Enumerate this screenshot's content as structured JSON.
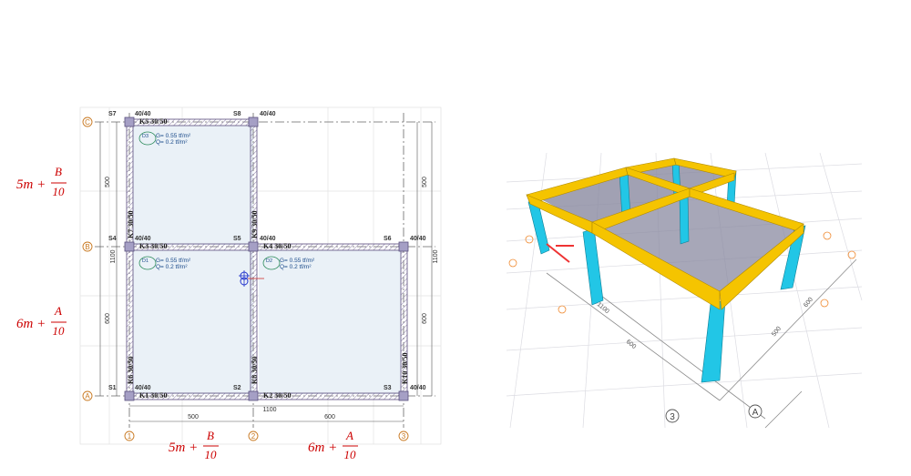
{
  "plan": {
    "grid_axes": {
      "vertical": [
        "1",
        "2",
        "3"
      ],
      "horizontal": [
        "A",
        "B",
        "C"
      ]
    },
    "columns": [
      {
        "id": "S1",
        "size": "40/40"
      },
      {
        "id": "S2",
        "size": ""
      },
      {
        "id": "S3",
        "size": "40/40"
      },
      {
        "id": "S4",
        "size": "40/40"
      },
      {
        "id": "S5",
        "size": "40/40"
      },
      {
        "id": "S6",
        "size": "40/40"
      },
      {
        "id": "S7",
        "size": "40/40"
      },
      {
        "id": "S8",
        "size": "40/40"
      }
    ],
    "beams": {
      "K1": "K1 30/50",
      "K2": "K2 30/50",
      "K3": "K3 30/50",
      "K4": "K4 30/50",
      "K5": "K5 30/50",
      "K6": "K6 30/50",
      "K7": "K7 30/50",
      "K8": "K8 30/50",
      "K9": "K9 30/50",
      "K10": "K10 30/50"
    },
    "slabs": [
      {
        "id": "D3",
        "g": "G= 0.55 tf/m²",
        "q": "Q= 0.2 tf/m²"
      },
      {
        "id": "D1",
        "g": "G= 0.55 tf/m²",
        "q": "Q= 0.2 tf/m²"
      },
      {
        "id": "D2",
        "g": "G= 0.55 tf/m²",
        "q": "Q= 0.2 tf/m²"
      }
    ],
    "dimensions": {
      "bottom_left": "500",
      "bottom_right": "600",
      "bottom_mid": "1100",
      "left_top": "500",
      "left_bottom": "600",
      "left_total": "1100",
      "right_top": "500",
      "right_bottom": "600",
      "right_total": "1100"
    }
  },
  "formulas": {
    "left_top": {
      "base": "5m +",
      "num": "B",
      "den": "10"
    },
    "left_bottom": {
      "base": "6m +",
      "num": "A",
      "den": "10"
    },
    "bottom_left": {
      "base": "5m +",
      "num": "B",
      "den": "10"
    },
    "bottom_right": {
      "base": "6m +",
      "num": "A",
      "den": "10"
    }
  },
  "view3d": {
    "axis_labels": [
      "3",
      "A"
    ],
    "dims": [
      "600",
      "500",
      "1100",
      "600"
    ],
    "colors": {
      "beam": "#f5c400",
      "column": "#22c6e6",
      "slab": "#8a8aa0",
      "grid": "#d9d9df"
    }
  }
}
